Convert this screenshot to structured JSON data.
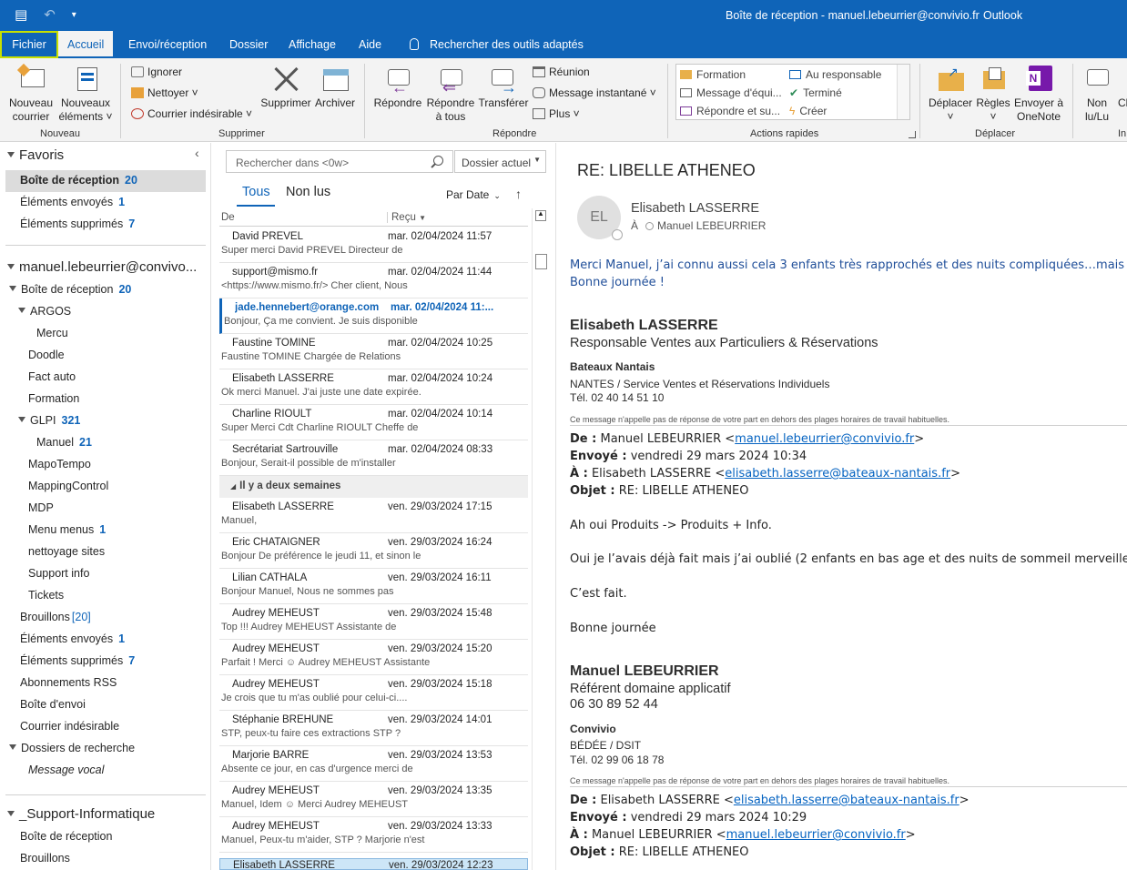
{
  "window": {
    "title": "Boîte de réception - manuel.lebeurrier@convivio.fr",
    "app": "Outlook"
  },
  "tabs": {
    "file": "Fichier",
    "home": "Accueil",
    "send_receive": "Envoi/réception",
    "folder": "Dossier",
    "view": "Affichage",
    "help": "Aide",
    "tell_me": "Rechercher des outils adaptés"
  },
  "ribbon": {
    "new_group": "Nouveau",
    "new_mail_1": "Nouveau",
    "new_mail_2": "courrier",
    "new_items_1": "Nouveaux",
    "new_items_2": "éléments ˅",
    "delete_group": "Supprimer",
    "ignore": "Ignorer",
    "clean": "Nettoyer ˅",
    "junk": "Courrier indésirable ˅",
    "delete": "Supprimer",
    "archive": "Archiver",
    "respond_group": "Répondre",
    "reply": "Répondre",
    "reply_all_1": "Répondre",
    "reply_all_2": "à tous",
    "forward": "Transférer",
    "meeting": "Réunion",
    "im": "Message instantané ˅",
    "more": "Plus ˅",
    "quick_steps_group": "Actions rapides",
    "qs": [
      "Formation",
      "Message d'équi...",
      "Répondre et su...",
      "Au responsable",
      "Terminé",
      "Créer"
    ],
    "move_group": "Déplacer",
    "move": "Déplacer",
    "move_caret": "˅",
    "rules": "Règles",
    "rules_caret": "˅",
    "onenote_1": "Envoyer à",
    "onenote_2": "OneNote",
    "unread_1": "Non",
    "unread_2": "lu/Lu",
    "cl": "Cl",
    "in": "In"
  },
  "folders": {
    "favorites": "Favoris",
    "fav_inbox": "Boîte de réception",
    "fav_inbox_count": "20",
    "fav_sent": "Éléments envoyés",
    "fav_sent_count": "1",
    "fav_deleted": "Éléments supprimés",
    "fav_deleted_count": "7",
    "account": "manuel.lebeurrier@convivo...",
    "inbox": "Boîte de réception",
    "inbox_count": "20",
    "argos": "ARGOS",
    "mercu": "Mercu",
    "doodle": "Doodle",
    "factauto": "Fact auto",
    "formation": "Formation",
    "glpi": "GLPI",
    "glpi_count": "321",
    "manuel": "Manuel",
    "manuel_count": "21",
    "mapotempo": "MapoTempo",
    "mappingcontrol": "MappingControl",
    "mdp": "MDP",
    "menumenus": "Menu menus",
    "menumenus_count": "1",
    "nettoyage": "nettoyage sites",
    "supportinfo": "Support info",
    "tickets": "Tickets",
    "drafts": "Brouillons",
    "drafts_count": "[20]",
    "sent": "Éléments envoyés",
    "sent_count": "1",
    "deleted": "Éléments supprimés",
    "deleted_count": "7",
    "rss": "Abonnements RSS",
    "outbox": "Boîte d'envoi",
    "junk": "Courrier indésirable",
    "search_folders": "Dossiers de recherche",
    "voicemail": "Message vocal",
    "support_account": "_Support-Informatique",
    "s_inbox": "Boîte de réception",
    "s_drafts": "Brouillons"
  },
  "list": {
    "search_placeholder": "Rechercher dans <0w>",
    "scope": "Dossier actuel",
    "tab_all": "Tous",
    "tab_unread": "Non lus",
    "sort": "Par Date",
    "col_from": "De",
    "col_received": "Reçu",
    "group_label": "Il y a deux semaines",
    "messages": [
      {
        "sender": "David PREVEL",
        "date": "mar. 02/04/2024 11:57",
        "preview": "Super merci   David PREVEL  Directeur de"
      },
      {
        "sender": "support@mismo.fr",
        "date": "mar. 02/04/2024 11:44",
        "preview": "<https://www.mismo.fr/>      Cher client,   Nous"
      },
      {
        "sender": "jade.hennebert@orange.com",
        "date": "mar. 02/04/2024 11:...",
        "preview": "Bonjour,    Ça me convient. Je suis disponible"
      },
      {
        "sender": "Faustine TOMINE",
        "date": "mar. 02/04/2024 10:25",
        "preview": "Faustine TOMINE  Chargée de Relations"
      },
      {
        "sender": "Elisabeth LASSERRE",
        "date": "mar. 02/04/2024 10:24",
        "preview": "Ok merci Manuel. J'ai juste une date expirée."
      },
      {
        "sender": "Charline RIOULT",
        "date": "mar. 02/04/2024 10:14",
        "preview": "Super Merci  Cdt  Charline RIOULT  Cheffe de"
      },
      {
        "sender": "Secrétariat Sartrouville",
        "date": "mar. 02/04/2024 08:33",
        "preview": "Bonjour,  Serait-il possible de m'installer"
      },
      {
        "sender": "Elisabeth LASSERRE",
        "date": "ven. 29/03/2024 17:15",
        "preview": "Manuel,"
      },
      {
        "sender": "Eric CHATAIGNER",
        "date": "ven. 29/03/2024 16:24",
        "preview": "Bonjour  De préférence le jeudi 11, et sinon le"
      },
      {
        "sender": "Lilian CATHALA",
        "date": "ven. 29/03/2024 16:11",
        "preview": "Bonjour Manuel,  Nous ne sommes pas"
      },
      {
        "sender": "Audrey MEHEUST",
        "date": "ven. 29/03/2024 15:48",
        "preview": "Top !!!  Audrey MEHEUST  Assistante de"
      },
      {
        "sender": "Audrey MEHEUST",
        "date": "ven. 29/03/2024 15:20",
        "preview": "Parfait !  Merci ☺  Audrey MEHEUST  Assistante"
      },
      {
        "sender": "Audrey MEHEUST",
        "date": "ven. 29/03/2024 15:18",
        "preview": "Je crois que tu m'as oublié pour celui-ci...."
      },
      {
        "sender": "Stéphanie BRÉHUNE",
        "date": "ven. 29/03/2024 14:01",
        "preview": "STP, peux-tu faire ces extractions STP ?"
      },
      {
        "sender": "Marjorie BARRÉ",
        "date": "ven. 29/03/2024 13:53",
        "preview": "Absente ce jour, en cas d'urgence merci de"
      },
      {
        "sender": "Audrey MEHEUST",
        "date": "ven. 29/03/2024 13:35",
        "preview": "Manuel,  Idem ☺   Merci  Audrey MEHEUST"
      },
      {
        "sender": "Audrey MEHEUST",
        "date": "ven. 29/03/2024 13:33",
        "preview": "Manuel,   Peux-tu m'aider, STP ?  Marjorie n'est"
      },
      {
        "sender": "Elisabeth LASSERRE",
        "date": "ven. 29/03/2024 12:23",
        "preview": ""
      }
    ]
  },
  "reading": {
    "subject": "RE: LIBELLE ATHENEO",
    "initials": "EL",
    "from": "Elisabeth LASSERRE",
    "to_label": "À",
    "to": "Manuel LEBEURRIER",
    "reply_line1": "Merci Manuel, j’ai connu aussi cela 3 enfants très rapprochés et des nuits compliquées…mais tu verras, ça passe vite",
    "reply_line2": "Bonne journée !",
    "sig1_name": "Elisabeth LASSERRE",
    "sig1_role": "Responsable Ventes aux Particuliers & Réservations",
    "sig1_company": "Bateaux Nantais",
    "sig1_dept": "NANTES / Service Ventes et Réservations Individuels",
    "sig1_tel": "Tél. 02 40 14 51 10",
    "disclaimer": "Ce message n'appelle pas de réponse de votre part en dehors des plages horaires de travail habituelles.",
    "h1_de_label": "De :",
    "h1_de": "Manuel LEBEURRIER <",
    "h1_de_mail": "manuel.lebeurrier@convivio.fr",
    "h1_env_label": "Envoyé :",
    "h1_env": "vendredi 29 mars 2024 10:34",
    "h1_a_label": "À :",
    "h1_a": "Elisabeth LASSERRE <",
    "h1_a_mail": "elisabeth.lasserre@bateaux-nantais.fr",
    "h1_obj_label": "Objet :",
    "h1_obj": "RE: LIBELLE ATHENEO",
    "close": ">",
    "b1": "Ah oui Produits -> Produits + Info.",
    "b2": "Oui je l’avais déjà fait mais j’ai oublié (2 enfants en bas age et des nuits de sommeil merveilleuses =).",
    "b3": "C’est fait.",
    "b4": "Bonne journée",
    "sig2_name": "Manuel LEBEURRIER",
    "sig2_role": "Référent domaine applicatif",
    "sig2_phone": "06 30 89 52 44",
    "sig2_company": "Convivio",
    "sig2_dept": "BÉDÉE / DSIT",
    "sig2_tel": "Tél. 02 99 06 18 78",
    "h2_de": "Elisabeth LASSERRE <",
    "h2_de_mail": "elisabeth.lasserre@bateaux-nantais.fr",
    "h2_env": "vendredi 29 mars 2024 10:29",
    "h2_a": "Manuel LEBEURRIER <",
    "h2_a_mail": "manuel.lebeurrier@convivio.fr",
    "h2_obj": "RE: LIBELLE ATHENEO"
  },
  "colors": {
    "brand": "#0f64b8",
    "file_tab_border": "#c7e000"
  }
}
